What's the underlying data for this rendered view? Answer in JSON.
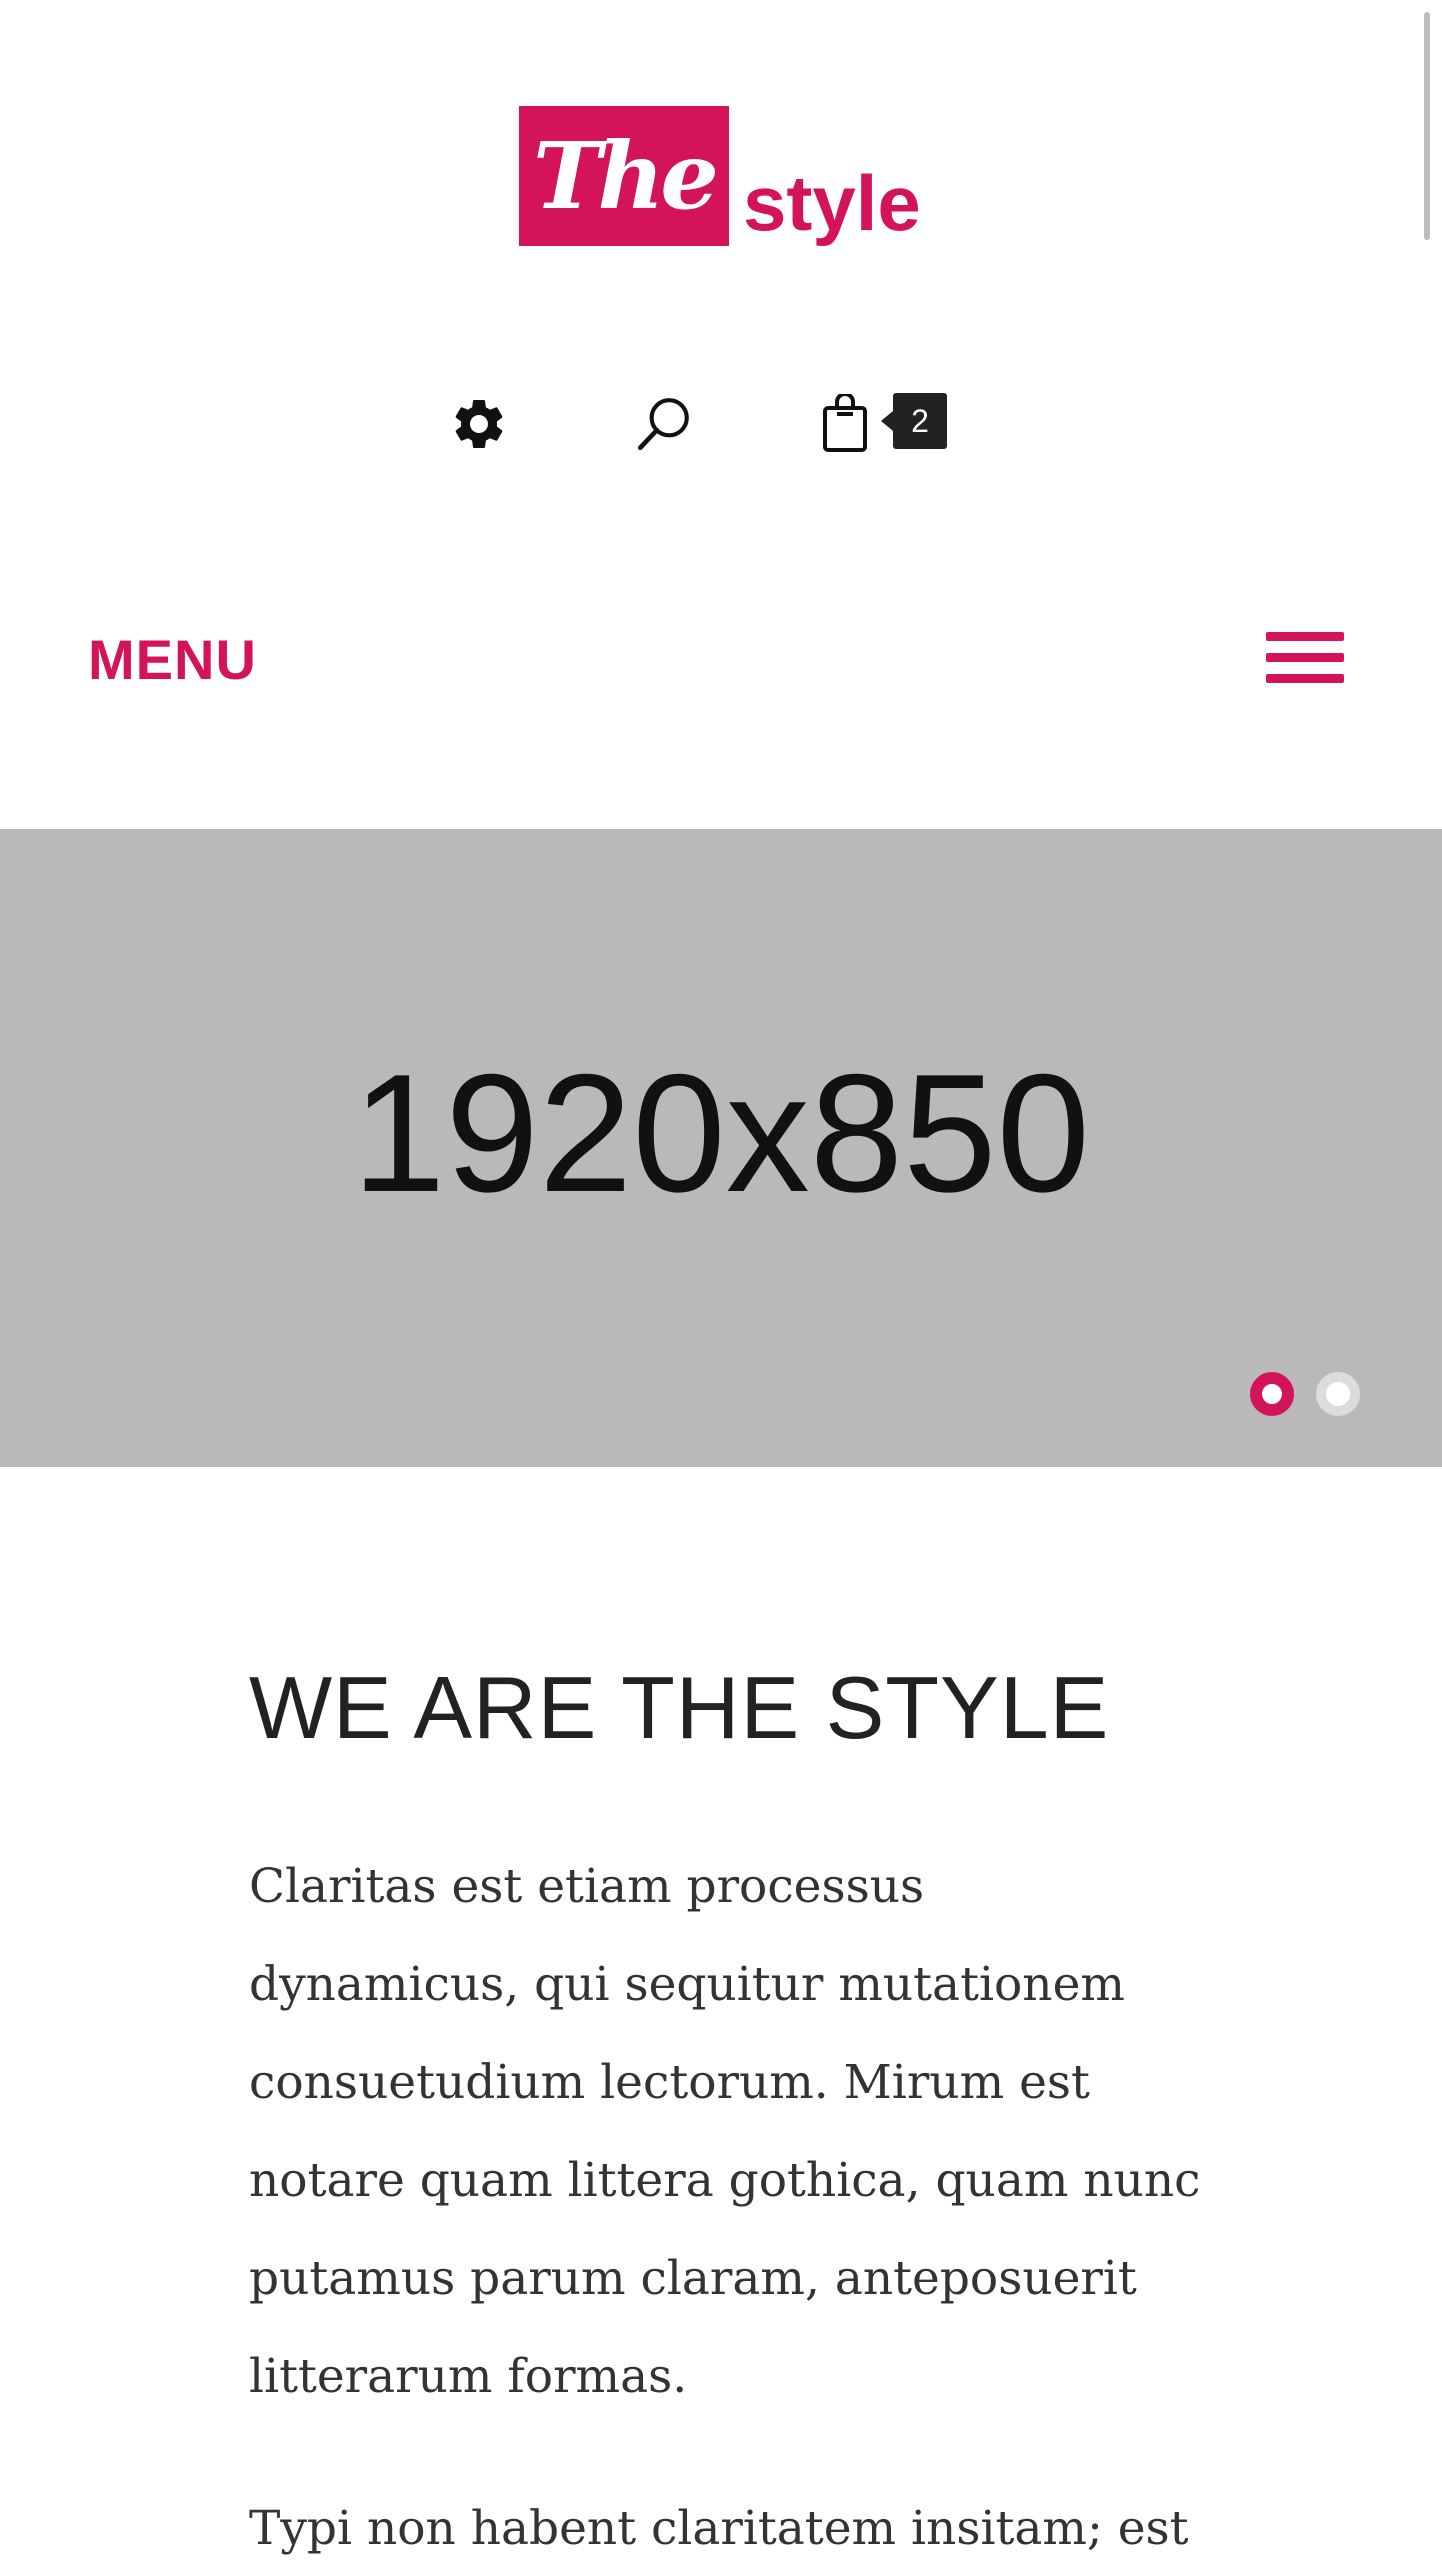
{
  "logo": {
    "mark": "The",
    "word": "style",
    "brand_color": "#d4145a"
  },
  "header": {
    "icons": [
      "gear-icon",
      "search-icon",
      "shopping-bag-icon"
    ],
    "cart_count": "2"
  },
  "nav": {
    "menu_label": "MENU",
    "toggle_icon": "hamburger-icon"
  },
  "hero": {
    "placeholder_text": "1920x850",
    "slides": [
      {
        "state": "active"
      },
      {
        "state": "inactive"
      }
    ]
  },
  "content": {
    "title": "WE ARE THE STYLE",
    "paragraphs": [
      "Claritas est etiam processus dynamicus, qui sequitur mutationem consuetudium lectorum. Mirum est notare quam littera gothica, quam nunc putamus parum claram, anteposuerit litterarum formas.",
      "Typi non habent claritatem insitam; est"
    ]
  }
}
